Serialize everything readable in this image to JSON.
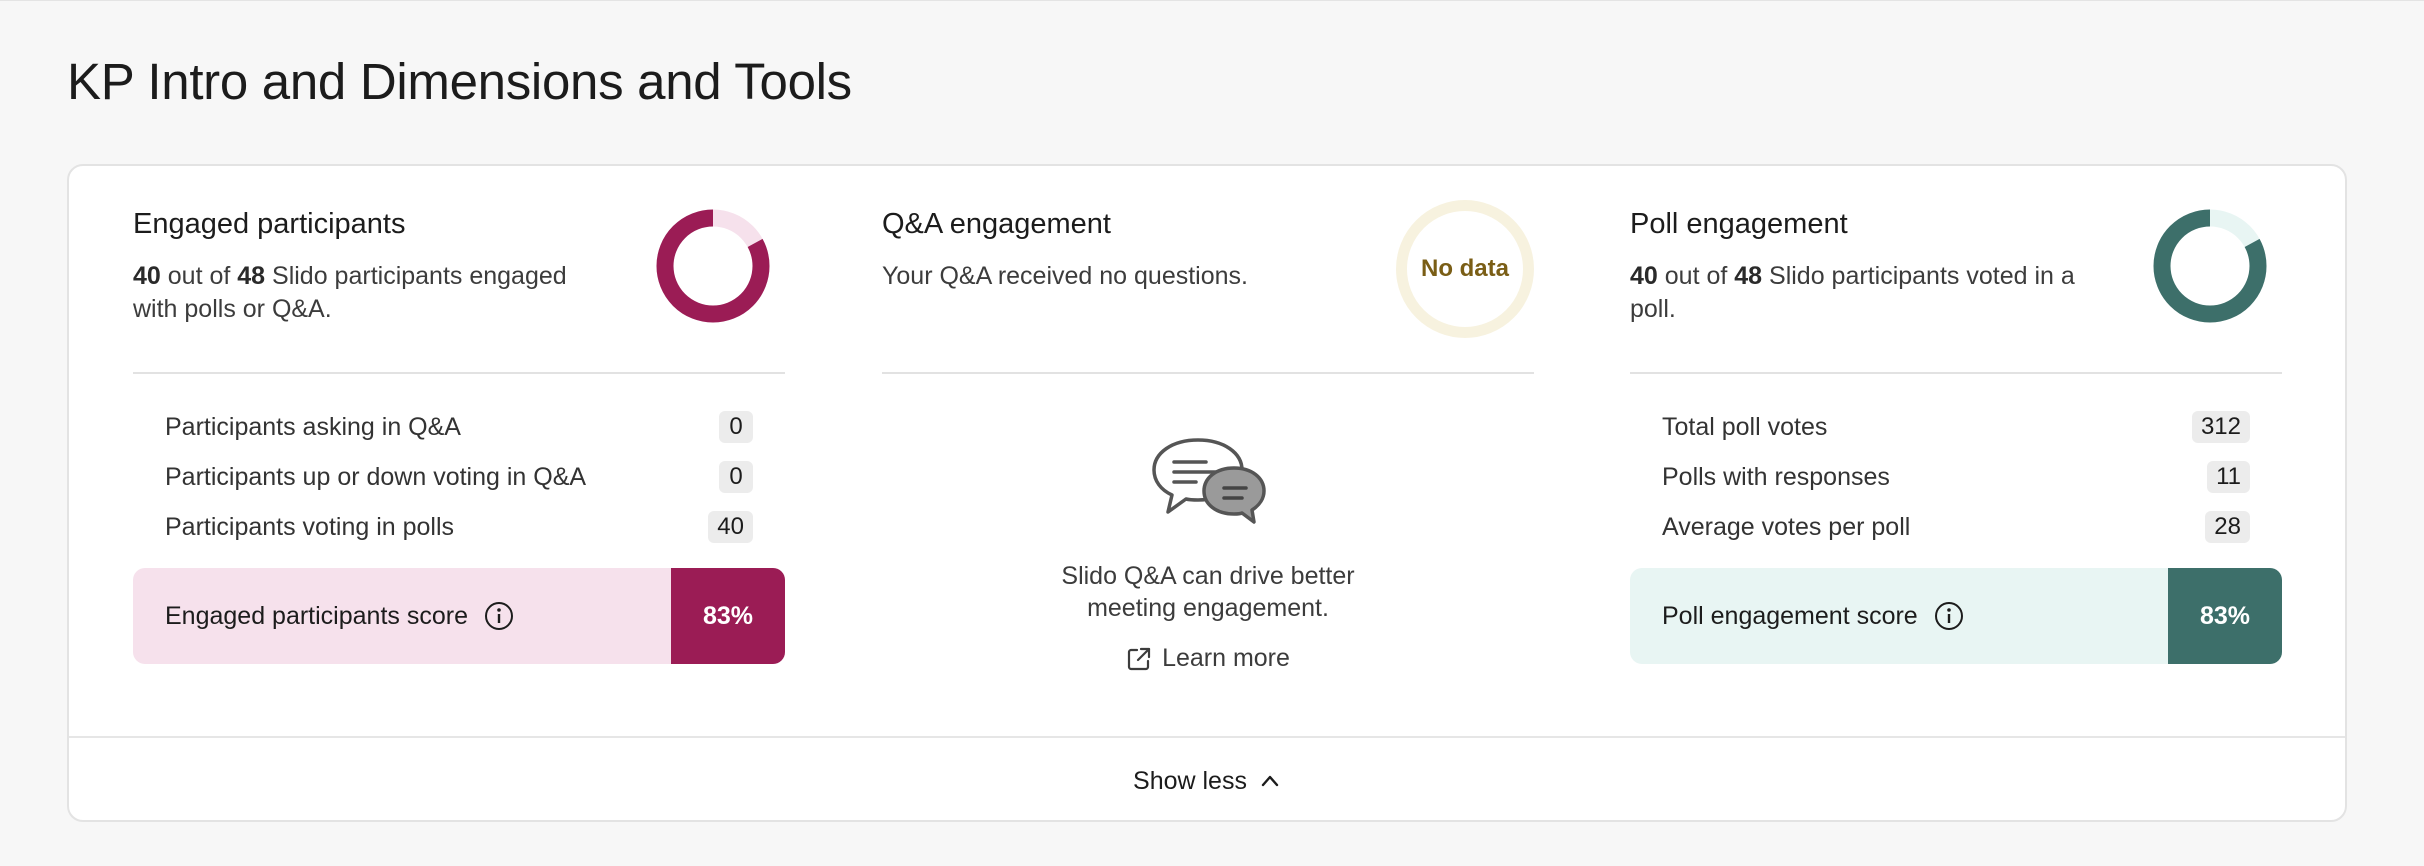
{
  "page": {
    "title": "KP Intro and Dimensions and Tools"
  },
  "engaged": {
    "title": "Engaged participants",
    "desc_count": "40",
    "desc_mid": " out of ",
    "desc_total": "48",
    "desc_rest": " Slido participants engaged with polls or Q&A.",
    "ratio": 0.83,
    "color": "#9b1c55",
    "track_color": "#f6e1ec",
    "metrics": [
      {
        "label": "Participants asking in Q&A",
        "value": "0"
      },
      {
        "label": "Participants up or down voting in Q&A",
        "value": "0"
      },
      {
        "label": "Participants voting in polls",
        "value": "40"
      }
    ],
    "score_label": "Engaged participants score",
    "score_value": "83%",
    "info_icon": "info-icon"
  },
  "qa": {
    "title": "Q&A engagement",
    "desc": "Your Q&A received no questions.",
    "no_data": "No data",
    "illustration_icon": "chat-bubbles-icon",
    "promo_line1": "Slido Q&A can drive better",
    "promo_line2": "meeting engagement.",
    "learn_more": "Learn more",
    "learn_more_icon": "external-link-icon"
  },
  "poll": {
    "title": "Poll engagement",
    "desc_count": "40",
    "desc_mid": " out of ",
    "desc_total": "48",
    "desc_rest": " Slido participants voted in a poll.",
    "ratio": 0.83,
    "color": "#3d6f6a",
    "track_color": "#e8f5f3",
    "metrics": [
      {
        "label": "Total poll votes",
        "value": "312"
      },
      {
        "label": "Polls with responses",
        "value": "11"
      },
      {
        "label": "Average votes per poll",
        "value": "28"
      }
    ],
    "score_label": "Poll engagement score",
    "score_value": "83%",
    "info_icon": "info-icon"
  },
  "footer": {
    "show_less": "Show less",
    "chevron_icon": "chevron-up-icon"
  }
}
